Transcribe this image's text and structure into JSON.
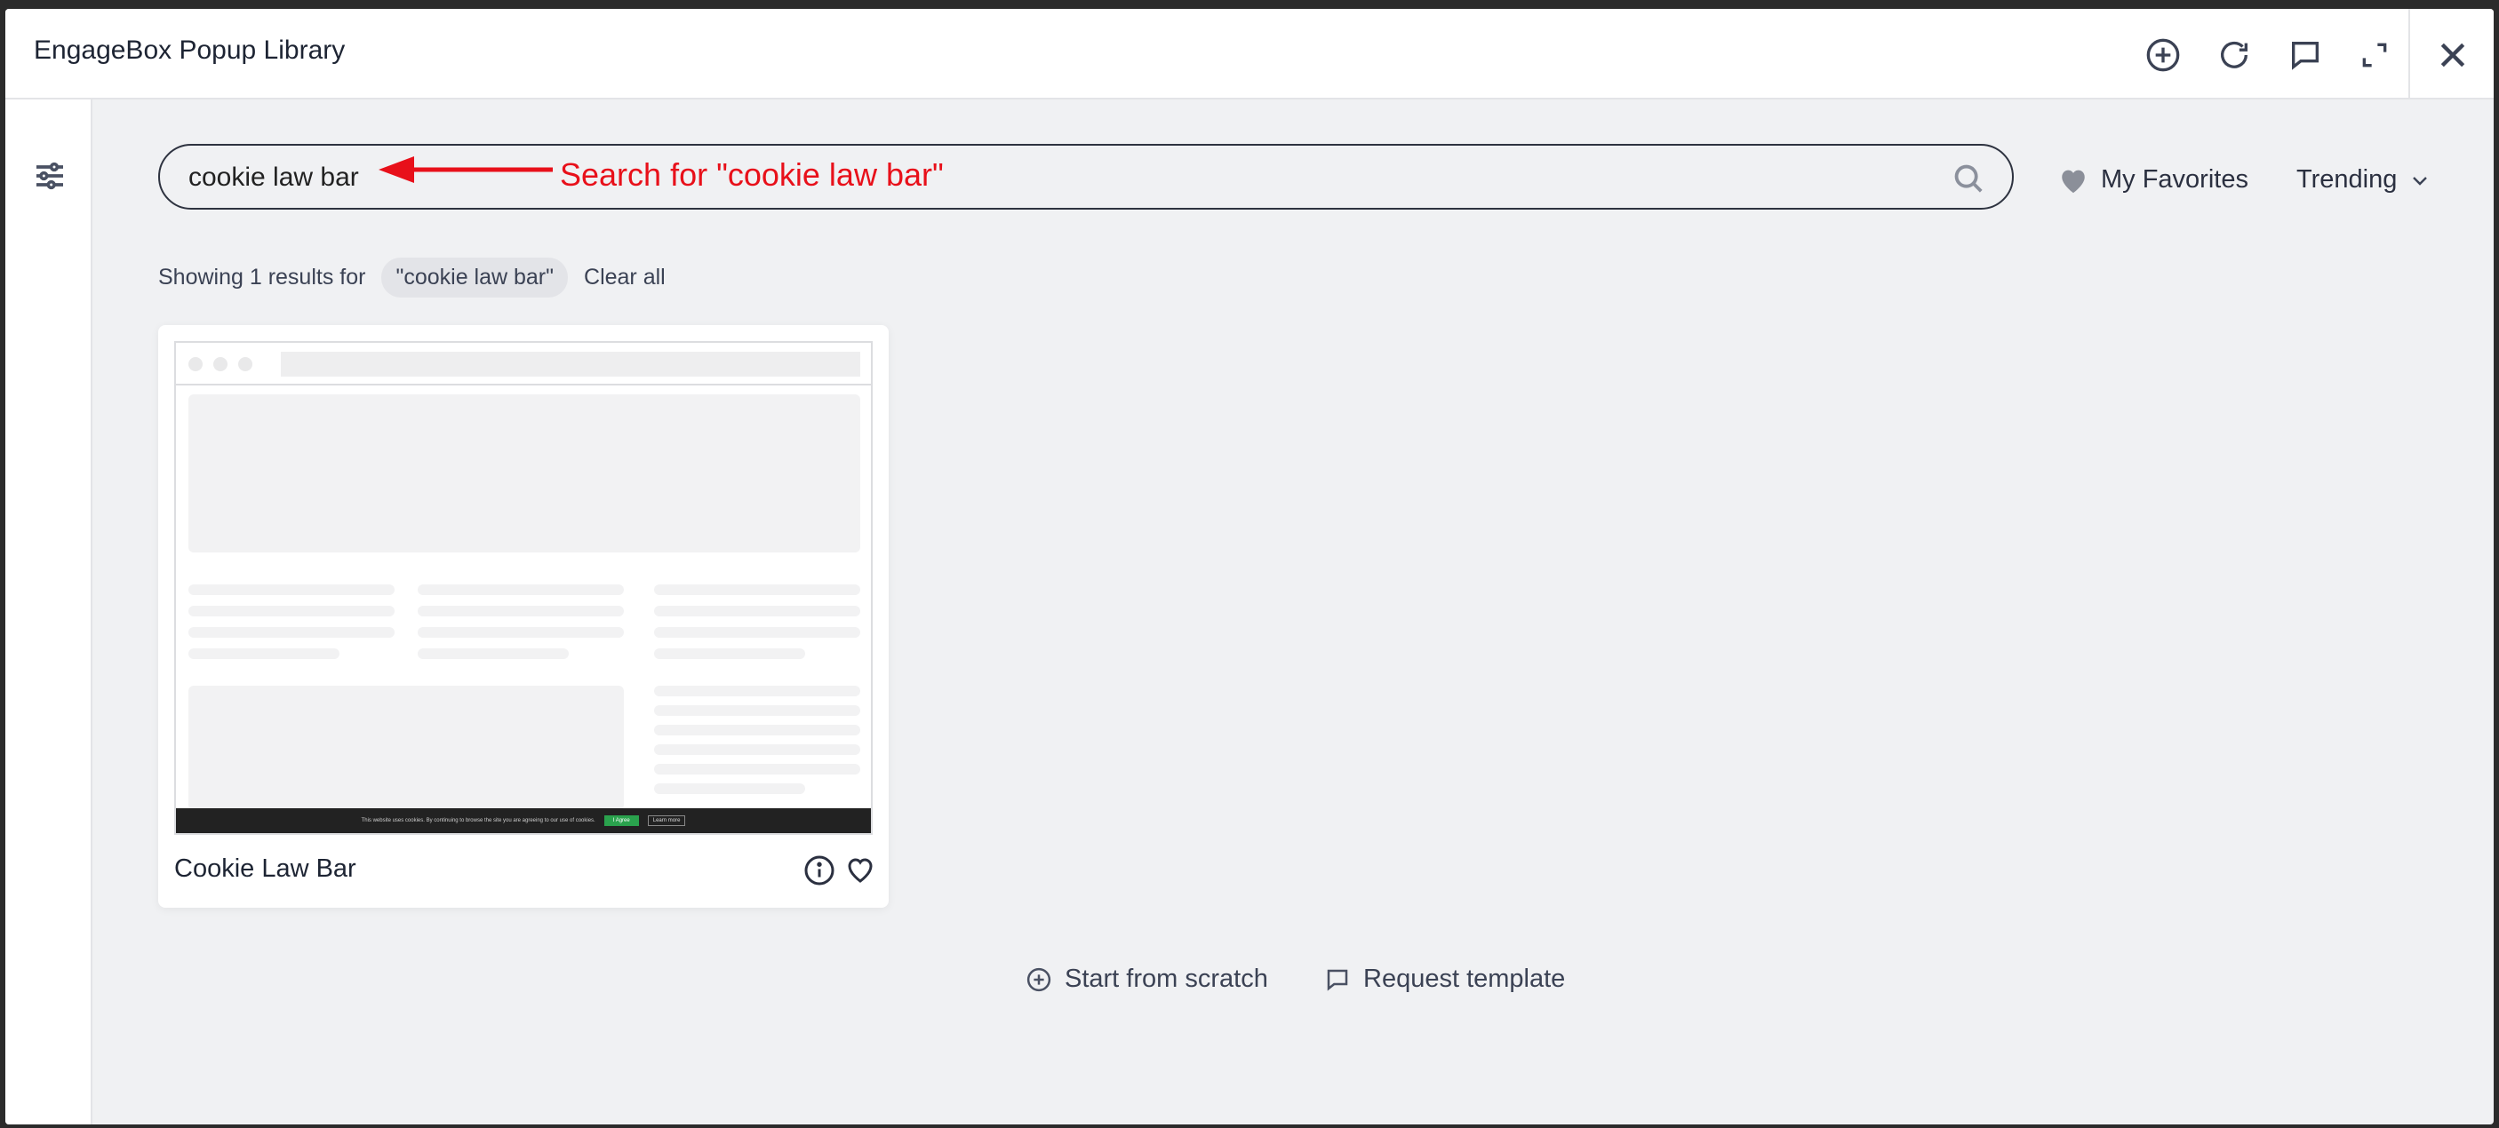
{
  "header": {
    "title": "EngageBox Popup Library",
    "icons": [
      "add-circle-icon",
      "refresh-icon",
      "chat-icon",
      "expand-icon",
      "close-icon"
    ]
  },
  "search": {
    "value": "cookie law bar",
    "placeholder": ""
  },
  "annotation": {
    "text": "Search for \"cookie law bar\"",
    "color": "#e8101a"
  },
  "toolbar": {
    "favorites_label": "My Favorites",
    "sort_label": "Trending"
  },
  "results": {
    "label": "Showing 1 results for",
    "query_chip": "\"cookie law bar\"",
    "clear_label": "Clear all"
  },
  "templates": [
    {
      "title": "Cookie Law Bar",
      "preview": {
        "cookie_text": "This website uses cookies. By continuing to browse the site you are agreeing to our use of cookies.",
        "accept": "I Agree",
        "more": "Learn more"
      }
    }
  ],
  "footer": {
    "start_label": "Start from scratch",
    "request_label": "Request template"
  }
}
